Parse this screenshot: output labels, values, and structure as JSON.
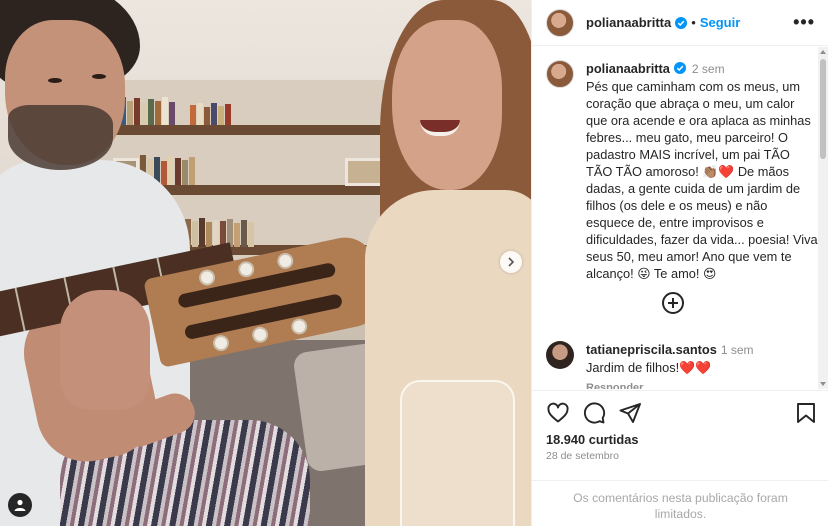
{
  "post": {
    "username": "polianaabritta",
    "follow_label": "Seguir",
    "more_label": "•••",
    "dot": "•"
  },
  "caption": {
    "username": "polianaabritta",
    "time": "2 sem",
    "text": "Pés que caminham com os meus, um coração que abraça o meu, um calor que ora acende e ora aplaca as minhas febres... meu gato, meu parceiro! O padastro MAIS incrível, um pai TÃO TÃO TÃO amoroso! 👏🏽❤️ De mãos dadas, a gente cuida de um jardim de filhos (os dele e os meus) e não esquece de, entre improvisos e dificuldades, fazer da vida... poesia! Viva seus 50, meu amor! Ano que vem te alcanço! 😜 Te amo! 😍"
  },
  "comments": [
    {
      "username": "tatianepriscila.santos",
      "time": "1 sem",
      "text": "Jardim de filhos!❤️❤️",
      "reply_label": "Responder"
    }
  ],
  "stats": {
    "likes": "18.940 curtidas",
    "date": "28 de setembro"
  },
  "footer": {
    "text": "Os comentários nesta publicação foram limitados."
  },
  "colors": {
    "link": "#0095f6",
    "verified": "#0095f6",
    "muted": "#8e8e8e",
    "text": "#262626"
  },
  "icons": [
    "heart-icon",
    "comment-icon",
    "share-icon",
    "bookmark-icon",
    "more-icon",
    "verified-icon",
    "add-circle-icon",
    "chevron-right-icon",
    "user-tag-icon"
  ]
}
